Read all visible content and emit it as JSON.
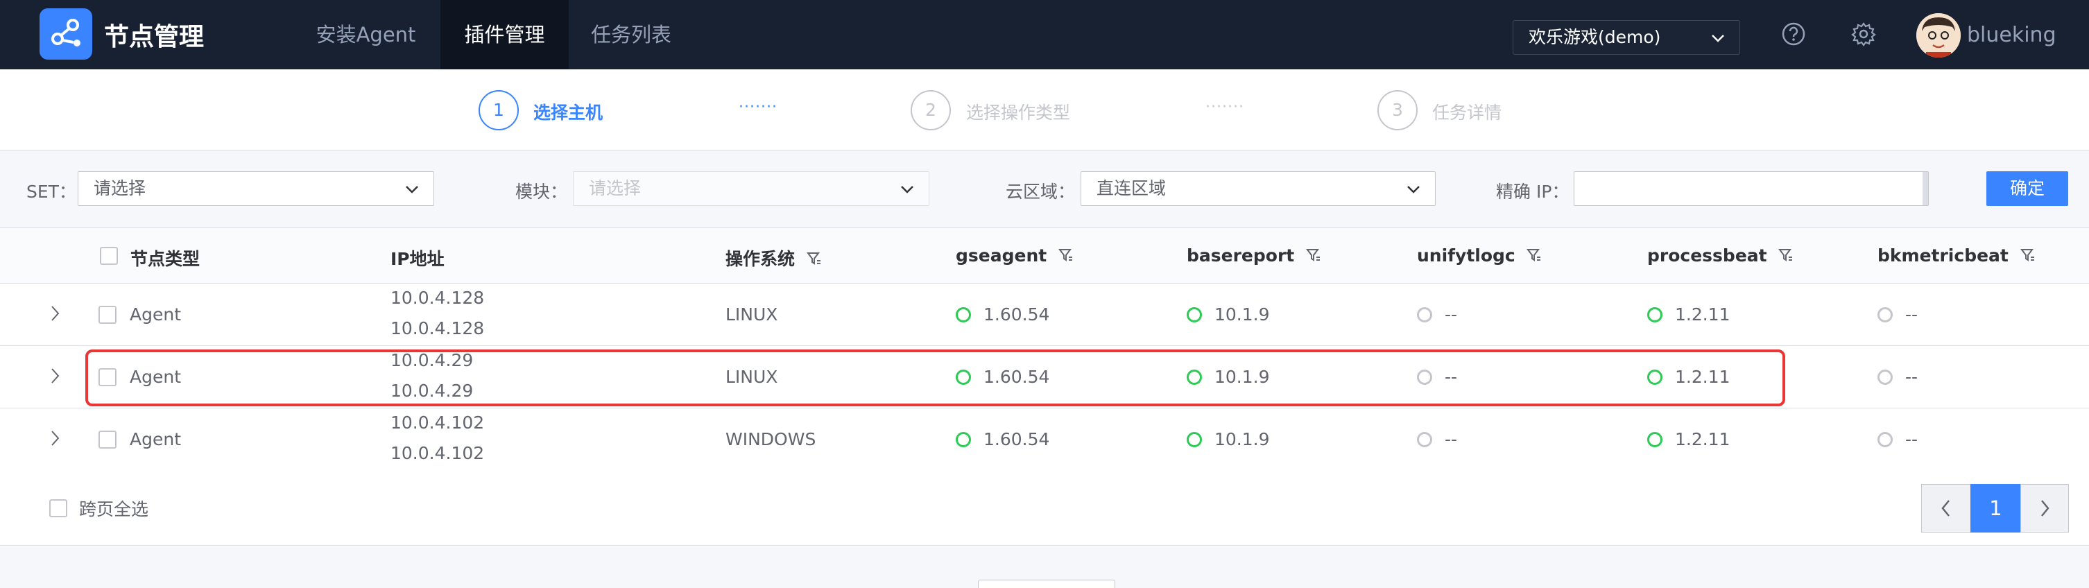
{
  "header": {
    "title": "节点管理",
    "nav": [
      {
        "label": "安装Agent",
        "active": false
      },
      {
        "label": "插件管理",
        "active": true
      },
      {
        "label": "任务列表",
        "active": false
      }
    ],
    "business": "欢乐游戏(demo)",
    "username": "blueking"
  },
  "steps": [
    {
      "num": "1",
      "label": "选择主机",
      "active": true
    },
    {
      "num": "2",
      "label": "选择操作类型",
      "active": false
    },
    {
      "num": "3",
      "label": "任务详情",
      "active": false
    }
  ],
  "step_separator": "·······",
  "filters": {
    "set_label": "SET：",
    "set_value": "请选择",
    "module_label": "模块：",
    "module_value": "请选择",
    "cloud_label": "云区域：",
    "cloud_value": "直连区域",
    "ip_label": "精确 IP：",
    "ip_value": "",
    "confirm": "确定"
  },
  "table": {
    "columns": [
      "节点类型",
      "IP地址",
      "操作系统",
      "gseagent",
      "basereport",
      "unifytlogc",
      "processbeat",
      "bkmetricbeat"
    ],
    "rows": [
      {
        "type": "Agent",
        "ip1": "10.0.4.128",
        "ip2": "10.0.4.128",
        "os": "LINUX",
        "gseagent": "1.60.54",
        "basereport": "10.1.9",
        "unifytlogc": "--",
        "processbeat": "1.2.11",
        "bkmetricbeat": "--"
      },
      {
        "type": "Agent",
        "ip1": "10.0.4.29",
        "ip2": "10.0.4.29",
        "os": "LINUX",
        "gseagent": "1.60.54",
        "basereport": "10.1.9",
        "unifytlogc": "--",
        "processbeat": "1.2.11",
        "bkmetricbeat": "--"
      },
      {
        "type": "Agent",
        "ip1": "10.0.4.102",
        "ip2": "10.0.4.102",
        "os": "WINDOWS",
        "gseagent": "1.60.54",
        "basereport": "10.1.9",
        "unifytlogc": "--",
        "processbeat": "1.2.11",
        "bkmetricbeat": "--"
      }
    ],
    "select_all_pages": "跨页全选"
  },
  "pagination": {
    "current": "1"
  },
  "colors": {
    "nav_bg": "#182132",
    "primary": "#3a84ff",
    "status_on": "#2dcb56",
    "status_off": "#c4c6cc",
    "highlight": "#ea3636"
  }
}
